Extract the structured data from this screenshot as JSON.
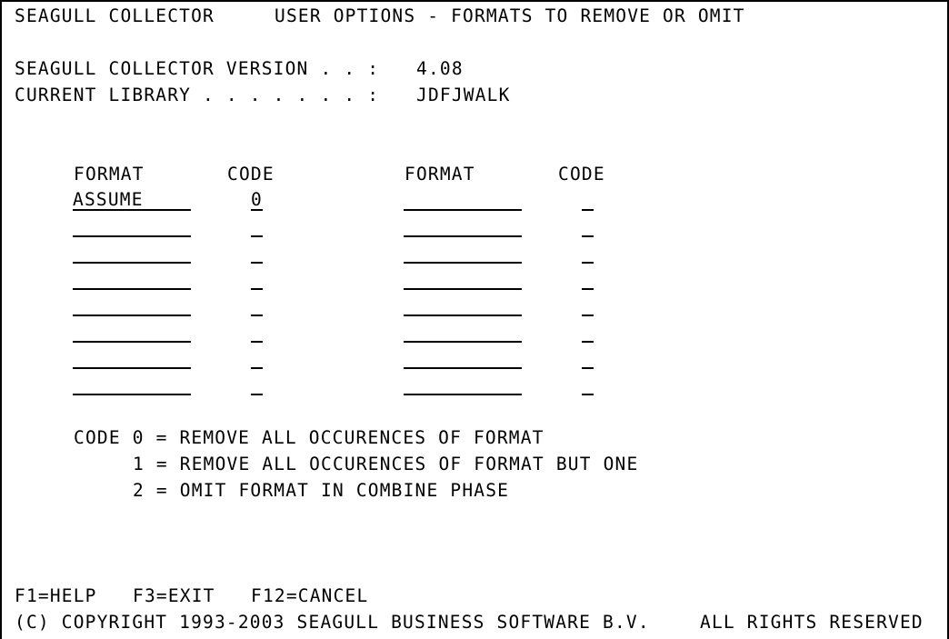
{
  "header": {
    "app_name": "SEAGULL COLLECTOR",
    "screen_title": "USER OPTIONS - FORMATS TO REMOVE OR OMIT"
  },
  "info": {
    "version_label": "SEAGULL COLLECTOR VERSION . . :",
    "version_value": "4.08",
    "library_label": "CURRENT LIBRARY . . . . . . . :",
    "library_value": "JDFJWALK"
  },
  "table": {
    "headers": {
      "format_1": "FORMAT",
      "code_1": "CODE",
      "format_2": "FORMAT",
      "code_2": "CODE"
    },
    "rows": [
      {
        "format_1": "ASSUME",
        "code_1": "0",
        "format_2": "",
        "code_2": ""
      },
      {
        "format_1": "",
        "code_1": "",
        "format_2": "",
        "code_2": ""
      },
      {
        "format_1": "",
        "code_1": "",
        "format_2": "",
        "code_2": ""
      },
      {
        "format_1": "",
        "code_1": "",
        "format_2": "",
        "code_2": ""
      },
      {
        "format_1": "",
        "code_1": "",
        "format_2": "",
        "code_2": ""
      },
      {
        "format_1": "",
        "code_1": "",
        "format_2": "",
        "code_2": ""
      },
      {
        "format_1": "",
        "code_1": "",
        "format_2": "",
        "code_2": ""
      },
      {
        "format_1": "",
        "code_1": "",
        "format_2": "",
        "code_2": ""
      }
    ]
  },
  "legend": {
    "line_0": "CODE 0 = REMOVE ALL OCCURENCES OF FORMAT",
    "line_1": "1 = REMOVE ALL OCCURENCES OF FORMAT BUT ONE",
    "line_2": "2 = OMIT FORMAT IN COMBINE PHASE"
  },
  "footer": {
    "f1": "F1=HELP",
    "f3": "F3=EXIT",
    "f12": "F12=CANCEL",
    "copyright": "(C) COPYRIGHT 1993-2003 SEAGULL BUSINESS SOFTWARE B.V.",
    "rights": "ALL RIGHTS RESERVED"
  }
}
